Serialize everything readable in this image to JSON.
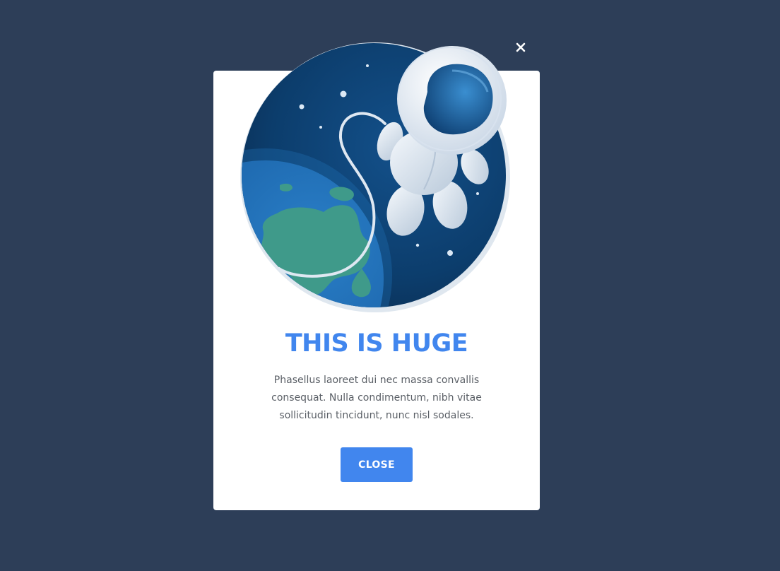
{
  "modal": {
    "close_icon_name": "close-icon",
    "illustration_icon_name": "astronaut-earth-illustration",
    "title": "THIS IS HUGE",
    "body": "Phasellus laoreet dui nec massa convallis consequat. Nulla condimentum, nibh vitae sollicitudin tincidunt, nunc nisl sodales.",
    "button_label": "CLOSE"
  },
  "colors": {
    "backdrop": "#2d3e58",
    "modal_background": "#ffffff",
    "accent": "#4186ee",
    "body_text": "#5a5f66"
  }
}
